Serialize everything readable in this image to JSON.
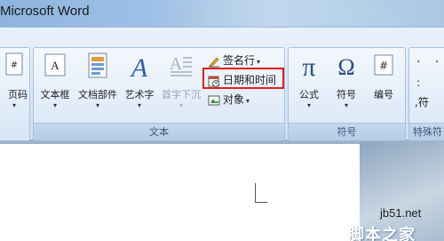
{
  "window": {
    "title": "Microsoft Word"
  },
  "ribbon": {
    "left_partial_label": "页码",
    "text_group": {
      "label": "文本",
      "buttons": [
        {
          "label": "文本框",
          "icon": "textbox-icon"
        },
        {
          "label": "文档部件",
          "icon": "quickparts-icon"
        },
        {
          "label": "艺术字",
          "icon": "wordart-icon"
        },
        {
          "label": "首字下沉",
          "icon": "dropcap-icon",
          "disabled": true
        }
      ],
      "small_buttons": [
        {
          "label": "签名行",
          "icon": "signature-line-icon",
          "has_dropdown": true
        },
        {
          "label": "日期和时间",
          "icon": "date-time-icon",
          "highlighted": true,
          "highlight_color": "#e02020"
        },
        {
          "label": "对象",
          "icon": "object-icon",
          "has_dropdown": true
        }
      ]
    },
    "symbols_group": {
      "label": "符号",
      "buttons": [
        {
          "label": "公式",
          "icon": "pi-equation-icon"
        },
        {
          "label": "符号",
          "icon": "omega-symbol-icon"
        },
        {
          "label": "编号",
          "icon": "number-icon"
        }
      ]
    },
    "special_group": {
      "label": "特殊符",
      "item": "符"
    }
  },
  "watermark": {
    "site": "jb51.net",
    "brand": "脚本之家"
  }
}
